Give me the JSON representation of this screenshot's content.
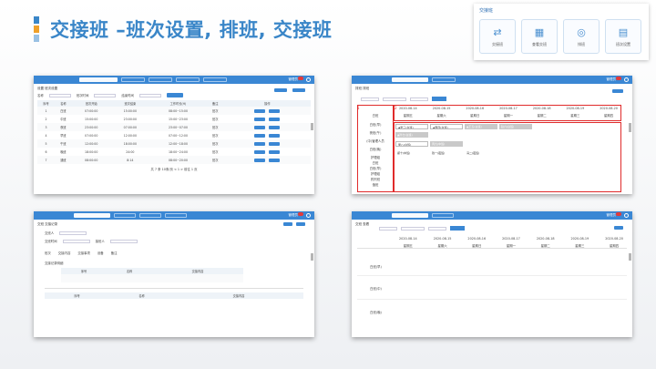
{
  "slide": {
    "title": "交接班 –班次设置, 排班, 交接班"
  },
  "feature_card": {
    "header": "交接班",
    "items": [
      {
        "label": "交接班",
        "icon": "swap-arrows-icon"
      },
      {
        "label": "查看交班",
        "icon": "calendar-icon"
      },
      {
        "label": "排班",
        "icon": "user-schedule-icon"
      },
      {
        "label": "班次设置",
        "icon": "document-settings-icon"
      }
    ]
  },
  "panel1": {
    "crumb": "设置   班次设置",
    "filters": {
      "name_label": "名称",
      "time_label": "班次时间",
      "end_label": "结束时间",
      "search": "查询"
    },
    "columns": [
      "序号",
      "名称",
      "班次开始",
      "班次结束",
      "工作时长(H)",
      "备注",
      "操作"
    ],
    "rows": [
      [
        "1",
        "白班",
        "07:00:00",
        "15:00:00",
        "08:00~15:00",
        "班次"
      ],
      [
        "2",
        "中班",
        "15:00:00",
        "23:00:00",
        "15:00~23:00",
        "班次"
      ],
      [
        "3",
        "夜班",
        "23:00:00",
        "07:00:00",
        "23:00~07:00",
        "班次"
      ],
      [
        "4",
        "早班",
        "07:00:00",
        "12:00:00",
        "07:00~12:00",
        "班次"
      ],
      [
        "5",
        "午班",
        "12:00:00",
        "18:00:00",
        "12:00~18:00",
        "班次"
      ],
      [
        "6",
        "晚班",
        "18:00:00",
        "24:00",
        "18:00~24:00",
        "班次"
      ],
      [
        "7",
        "通班",
        "08:00:00",
        "8:14",
        "08:00~20:00",
        "班次"
      ]
    ],
    "pagination": "共 7 条   10条/页   <   1   >   前往 1 页"
  },
  "panel2": {
    "crumb": "排班   排班",
    "marker1": "1",
    "marker2": "2",
    "side_rows": [
      "白班",
      "白班(早)",
      "夜班(午)",
      "(中)管理人员",
      "白班(晚)",
      "护理组",
      "白班",
      "白班(早)",
      "护理组",
      "药剂班",
      "值班"
    ],
    "dates": [
      "2020-08-14",
      "2020-08-15",
      "2020-08-16",
      "2020-08-17",
      "2020-08-18",
      "2020-08-19",
      "2020-08-20"
    ],
    "weekdays": [
      "星期五",
      "星期六",
      "星期日",
      "星期一",
      "星期二",
      "星期三",
      "星期四"
    ],
    "slots": [
      "▲张三(白班)",
      "▲李四(白班)",
      "▲王五(白班)",
      "赵六(白班)",
      "▲孙七(白班)",
      "吴八(白班)",
      "周九(中班)",
      "郑十(中班)",
      "钱一(夜班)",
      "冯二(夜班)"
    ]
  },
  "panel3": {
    "crumb": "交班   交接记录",
    "labels": [
      "交班人",
      "交班时间",
      "接班人",
      "班次",
      "交接内容",
      "交接事项",
      "设备",
      "备注"
    ],
    "section": "交接记录明细",
    "table_cols": [
      "序号",
      "名称",
      "交接内容"
    ]
  },
  "panel4": {
    "crumb": "交班   查看",
    "dates": [
      "2020-08-14",
      "2020-08-15",
      "2020-08-16",
      "2020-08-17",
      "2020-08-18",
      "2020-08-19",
      "2020-08-20"
    ],
    "weekdays": [
      "星期五",
      "星期六",
      "星期日",
      "星期一",
      "星期二",
      "星期三",
      "星期四"
    ],
    "side_rows": [
      "白班(早)",
      "白班(中)",
      "白班(晚)"
    ]
  }
}
